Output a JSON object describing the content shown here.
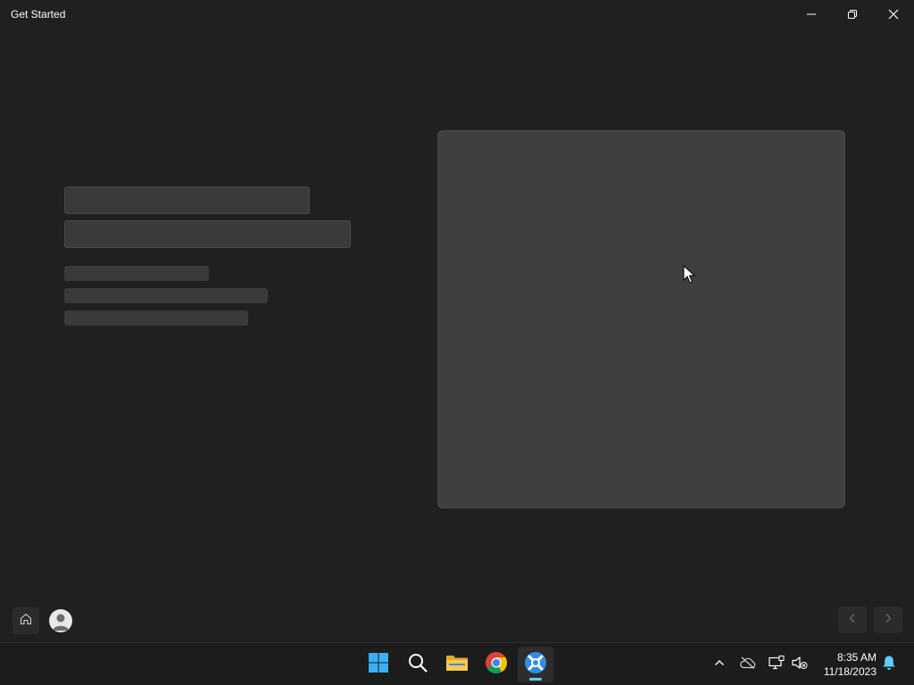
{
  "window": {
    "title": "Get Started"
  },
  "caption_buttons": {
    "minimize_icon": "minimize-icon",
    "restore_icon": "restore-icon",
    "close_icon": "close-icon"
  },
  "bottom_bar": {
    "home_icon": "home-icon",
    "account_icon": "account-icon",
    "back_icon": "chevron-left-icon",
    "forward_icon": "chevron-right-icon"
  },
  "taskbar": {
    "apps": [
      {
        "name": "Start",
        "icon": "windows-start-icon"
      },
      {
        "name": "Search",
        "icon": "search-icon"
      },
      {
        "name": "File Explorer",
        "icon": "folder-icon"
      },
      {
        "name": "Google Chrome",
        "icon": "chrome-icon"
      },
      {
        "name": "Get Started",
        "icon": "get-started-icon",
        "active": true
      }
    ],
    "tray": {
      "overflow_icon": "chevron-up-icon",
      "onedrive_icon": "cloud-offline-icon",
      "network_icon": "network-icon",
      "volume_icon": "volume-muted-icon",
      "notification_icon": "bell-icon"
    },
    "clock": {
      "time": "8:35 AM",
      "date": "11/18/2023"
    }
  },
  "colors": {
    "background": "#202020",
    "skeleton": "#3a3a3a",
    "panel": "#3f3f3f",
    "accent": "#60cdff"
  }
}
